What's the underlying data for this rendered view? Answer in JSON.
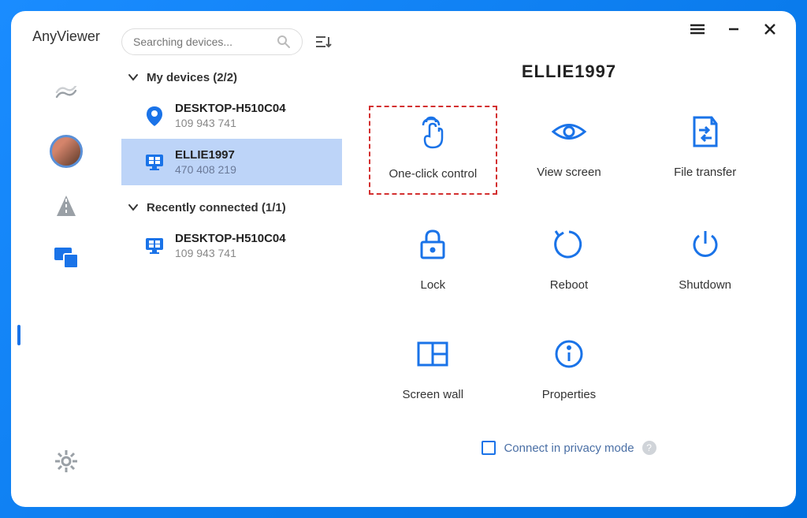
{
  "app": {
    "title": "AnyViewer"
  },
  "search": {
    "placeholder": "Searching devices..."
  },
  "groups": [
    {
      "label": "My devices (2/2)",
      "items": [
        {
          "name": "DESKTOP-H510C04",
          "id": "109 943 741",
          "icon": "pin",
          "selected": false
        },
        {
          "name": "ELLIE1997",
          "id": "470 408 219",
          "icon": "monitor",
          "selected": true
        }
      ]
    },
    {
      "label": "Recently connected (1/1)",
      "items": [
        {
          "name": "DESKTOP-H510C04",
          "id": "109 943 741",
          "icon": "monitor",
          "selected": false
        }
      ]
    }
  ],
  "detail": {
    "title": "ELLIE1997",
    "actions": [
      {
        "key": "one-click-control",
        "label": "One-click control",
        "highlighted": true
      },
      {
        "key": "view-screen",
        "label": "View screen",
        "highlighted": false
      },
      {
        "key": "file-transfer",
        "label": "File transfer",
        "highlighted": false
      },
      {
        "key": "lock",
        "label": "Lock",
        "highlighted": false
      },
      {
        "key": "reboot",
        "label": "Reboot",
        "highlighted": false
      },
      {
        "key": "shutdown",
        "label": "Shutdown",
        "highlighted": false
      },
      {
        "key": "screen-wall",
        "label": "Screen wall",
        "highlighted": false
      },
      {
        "key": "properties",
        "label": "Properties",
        "highlighted": false
      }
    ],
    "privacy_label": "Connect in privacy mode"
  }
}
